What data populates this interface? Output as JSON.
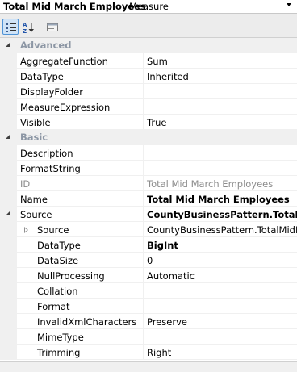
{
  "object_selector": {
    "name": "Total Mid March Employees",
    "type": "Measure"
  },
  "toolbar": {
    "buttons": [
      {
        "icon": "categorized-icon",
        "active": true
      },
      {
        "icon": "alphabetical-sort-icon",
        "active": false
      },
      {
        "icon": "property-pages-icon",
        "active": false
      }
    ]
  },
  "categories": {
    "advanced": "Advanced",
    "basic": "Basic"
  },
  "properties": {
    "aggregate_function": {
      "name": "AggregateFunction",
      "value": "Sum"
    },
    "data_type": {
      "name": "DataType",
      "value": "Inherited"
    },
    "display_folder": {
      "name": "DisplayFolder",
      "value": ""
    },
    "measure_expression": {
      "name": "MeasureExpression",
      "value": ""
    },
    "visible": {
      "name": "Visible",
      "value": "True"
    },
    "description": {
      "name": "Description",
      "value": ""
    },
    "format_string": {
      "name": "FormatString",
      "value": ""
    },
    "id": {
      "name": "ID",
      "value": "Total Mid March Employees"
    },
    "name": {
      "name": "Name",
      "value": "Total Mid March Employees"
    },
    "source": {
      "name": "Source",
      "value": "CountyBusinessPattern.TotalMidM"
    },
    "source_source": {
      "name": "Source",
      "value": "CountyBusinessPattern.TotalMidM"
    },
    "source_data_type": {
      "name": "DataType",
      "value": "BigInt"
    },
    "data_size": {
      "name": "DataSize",
      "value": "0"
    },
    "null_processing": {
      "name": "NullProcessing",
      "value": "Automatic"
    },
    "collation": {
      "name": "Collation",
      "value": ""
    },
    "format": {
      "name": "Format",
      "value": ""
    },
    "invalid_xml_characters": {
      "name": "InvalidXmlCharacters",
      "value": "Preserve"
    },
    "mime_type": {
      "name": "MimeType",
      "value": ""
    },
    "trimming": {
      "name": "Trimming",
      "value": "Right"
    }
  }
}
